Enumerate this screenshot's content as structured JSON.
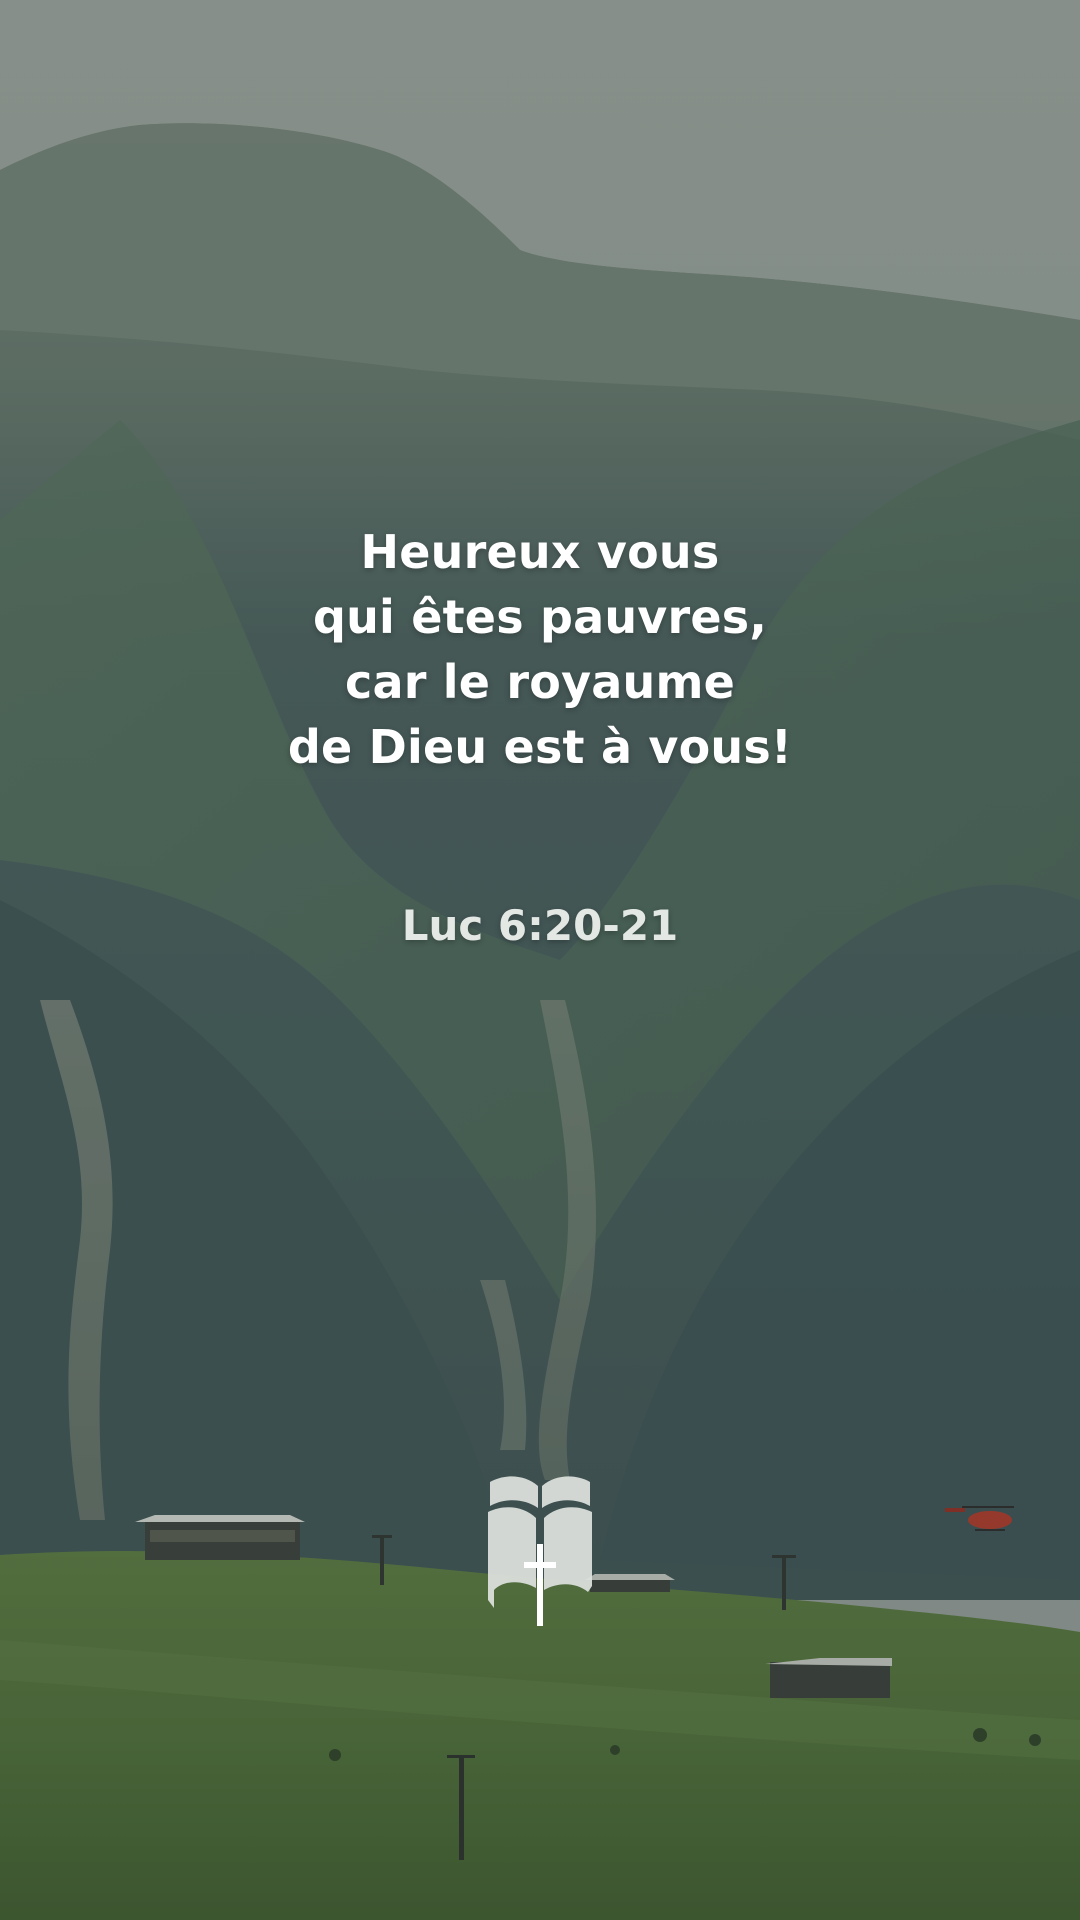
{
  "verse": {
    "lines": [
      "Heureux vous",
      "qui êtes pauvres,",
      "car le royaume",
      "de Dieu est à vous!"
    ]
  },
  "reference": "Luc 6:20-21",
  "background": {
    "description_icon": "mountain-landscape",
    "colors": {
      "sky": "#8e9790",
      "mountain_dark": "#3c5250",
      "mountain_mid": "#4d6659",
      "meadow": "#4d6a3a",
      "text": "#ffffff"
    }
  },
  "logo": {
    "icon": "bible-cross-logo-icon",
    "color": "#dfe3df"
  }
}
